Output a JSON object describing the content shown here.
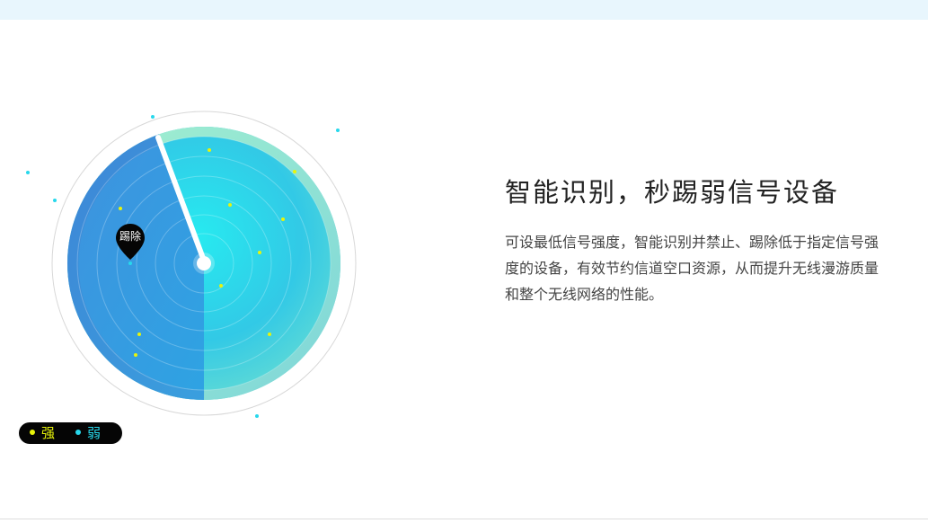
{
  "feature": {
    "heading": "智能识别，秒踢弱信号设备",
    "description": "可设最低信号强度，智能识别并禁止、踢除低于指定信号强度的设备，有效节约信道空口资源，从而提升无线漫游质量和整个无线网络的性能。"
  },
  "radar": {
    "kick_label": "踢除"
  },
  "legend": {
    "strong_label": "强",
    "weak_label": "弱",
    "strong_color": "#e8f40a",
    "weak_color": "#27d8ec"
  }
}
